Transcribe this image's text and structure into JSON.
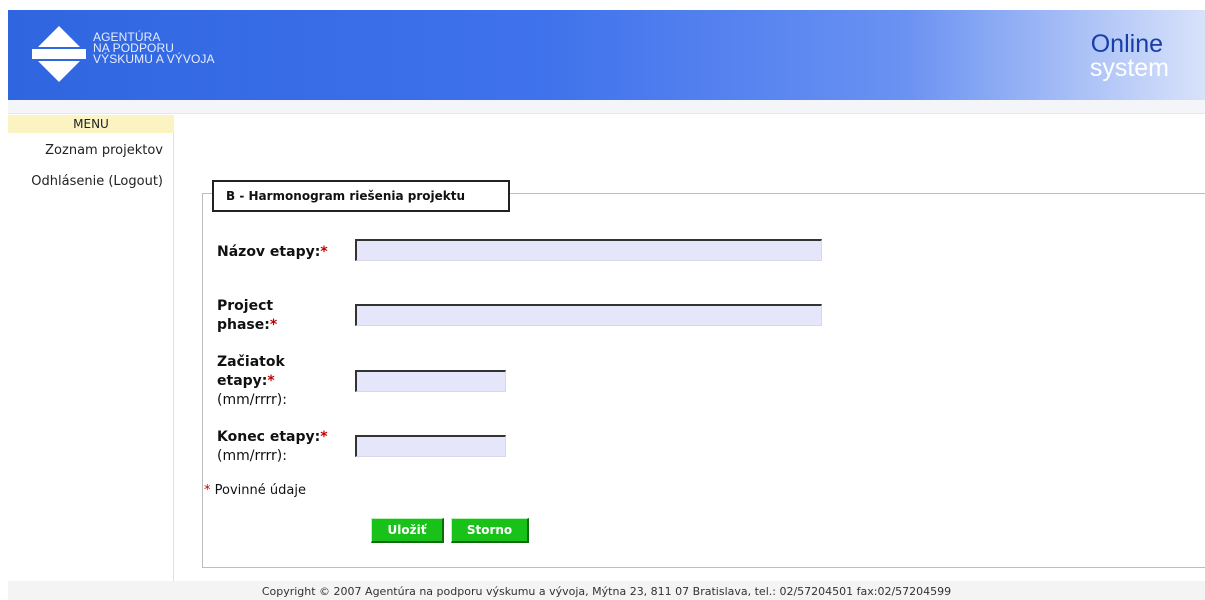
{
  "header": {
    "logo_lines": [
      "AGENTÚRA",
      "NA PODPORU",
      "VÝSKUMU A VÝVOJA"
    ],
    "system_line1": "Online",
    "system_line2": "system",
    "bg_color": "#3b6fe8"
  },
  "sidebar": {
    "title": "MENU",
    "items": [
      {
        "label": "Zoznam projektov"
      },
      {
        "label": "Odhlásenie (Logout)"
      }
    ]
  },
  "form": {
    "legend": "B - Harmonogram riešenia projektu",
    "fields": [
      {
        "label": "Názov etapy:",
        "value": ""
      },
      {
        "label_line1": "Project",
        "label_line2": "phase:",
        "value": ""
      },
      {
        "label_line1": "Začiatok",
        "label_line2": "etapy:",
        "unit": "(mm/rrrr):",
        "value": ""
      },
      {
        "label": "Konec etapy:",
        "unit": "(mm/rrrr):",
        "value": ""
      }
    ],
    "required_mark": "*",
    "required_note": "Povinné údaje",
    "buttons": {
      "save": "Uložiť",
      "cancel": "Storno",
      "color": "#19c219"
    }
  },
  "footer": {
    "text": "Copyright © 2007 Agentúra na podporu výskumu a vývoja, Mýtna 23, 811 07 Bratislava, tel.: 02/57204501 fax:02/57204599"
  }
}
